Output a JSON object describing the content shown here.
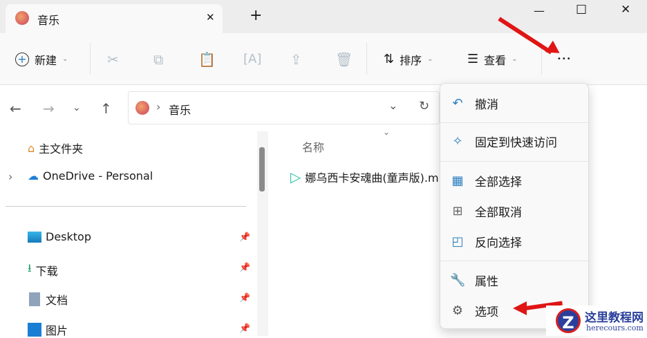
{
  "window": {
    "tab_title": "音乐",
    "new_tab": "+",
    "minimize": "—",
    "maximize": "☐",
    "close": "✕",
    "tab_close": "✕"
  },
  "toolbar": {
    "new_label": "新建",
    "sort_label": "排序",
    "view_label": "查看",
    "more": "•••"
  },
  "address": {
    "path": "音乐",
    "separator": "›"
  },
  "sidebar": {
    "items": [
      {
        "label": "主文件夹",
        "icon": "home-icon"
      },
      {
        "label": "OneDrive - Personal",
        "icon": "cloud-icon"
      },
      {
        "label": "Desktop",
        "icon": "desktop-icon"
      },
      {
        "label": "下载",
        "icon": "download-icon"
      },
      {
        "label": "文档",
        "icon": "document-icon"
      },
      {
        "label": "图片",
        "icon": "picture-icon"
      }
    ]
  },
  "content": {
    "column_name": "名称",
    "files": [
      {
        "name": "娜乌西卡安魂曲(童声版).m"
      }
    ]
  },
  "menu": {
    "items": [
      "撤消",
      "固定到快速访问",
      "全部选择",
      "全部取消",
      "反向选择",
      "属性",
      "选项"
    ]
  },
  "watermark": {
    "title": "这里教程网",
    "url": "herecours.com"
  },
  "colors": {
    "accent": "#2a7fc0",
    "arrow": "#e01515"
  }
}
